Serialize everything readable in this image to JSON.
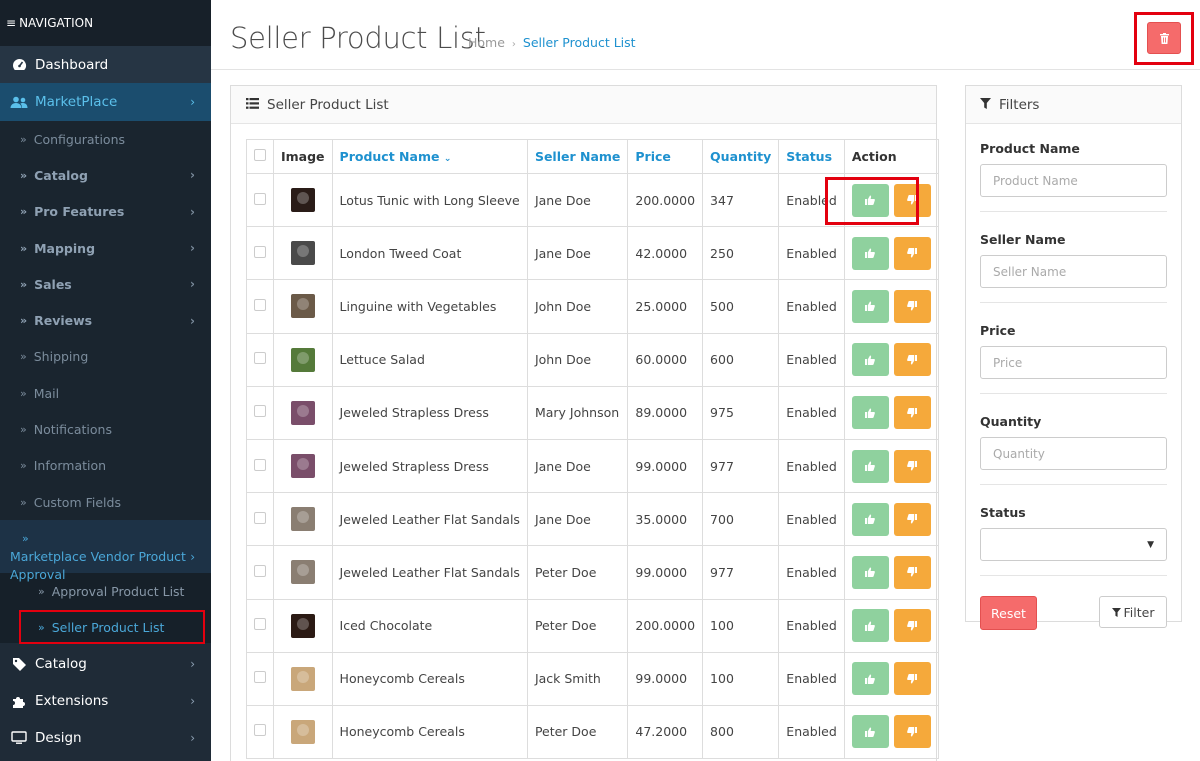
{
  "sidebar": {
    "heading": "NAVIGATION",
    "dashboard": "Dashboard",
    "marketplace": "MarketPlace",
    "marketplace_sub": [
      {
        "label": "Configurations",
        "bold": false,
        "chev": false
      },
      {
        "label": "Catalog",
        "bold": true,
        "chev": true
      },
      {
        "label": "Pro Features",
        "bold": true,
        "chev": true
      },
      {
        "label": "Mapping",
        "bold": true,
        "chev": true
      },
      {
        "label": "Sales",
        "bold": true,
        "chev": true
      },
      {
        "label": "Reviews",
        "bold": true,
        "chev": true
      },
      {
        "label": "Shipping",
        "bold": false,
        "chev": false
      },
      {
        "label": "Mail",
        "bold": false,
        "chev": false
      },
      {
        "label": "Notifications",
        "bold": false,
        "chev": false
      },
      {
        "label": "Information",
        "bold": false,
        "chev": false
      },
      {
        "label": "Custom Fields",
        "bold": false,
        "chev": false
      }
    ],
    "mvpa": "Marketplace Vendor Product Approval",
    "approval_product_list": "Approval Product List",
    "seller_product_list": "Seller Product List",
    "catalog": "Catalog",
    "extensions": "Extensions",
    "design": "Design"
  },
  "header": {
    "title": "Seller Product List",
    "crumb_home": "Home",
    "crumb_current": "Seller Product List"
  },
  "panel": {
    "title": "Seller Product List",
    "columns": [
      "Image",
      "Product Name",
      "Seller Name",
      "Price",
      "Quantity",
      "Status",
      "Action"
    ],
    "rows": [
      {
        "name": "Lotus Tunic with Long Sleeve",
        "seller": "Jane Doe",
        "price": "200.0000",
        "qty": "347",
        "status": "Enabled",
        "img": "#2a1c18"
      },
      {
        "name": "London Tweed Coat",
        "seller": "Jane Doe",
        "price": "42.0000",
        "qty": "250",
        "status": "Enabled",
        "img": "#4a4a4a"
      },
      {
        "name": "Linguine with Vegetables",
        "seller": "John Doe",
        "price": "25.0000",
        "qty": "500",
        "status": "Enabled",
        "img": "#6b5a48"
      },
      {
        "name": "Lettuce Salad",
        "seller": "John Doe",
        "price": "60.0000",
        "qty": "600",
        "status": "Enabled",
        "img": "#557a3a"
      },
      {
        "name": "Jeweled Strapless Dress",
        "seller": "Mary Johnson",
        "price": "89.0000",
        "qty": "975",
        "status": "Enabled",
        "img": "#7a4e6a"
      },
      {
        "name": "Jeweled Strapless Dress",
        "seller": "Jane Doe",
        "price": "99.0000",
        "qty": "977",
        "status": "Enabled",
        "img": "#7a4e6a"
      },
      {
        "name": "Jeweled Leather Flat Sandals",
        "seller": "Jane Doe",
        "price": "35.0000",
        "qty": "700",
        "status": "Enabled",
        "img": "#8a7e72"
      },
      {
        "name": "Jeweled Leather Flat Sandals",
        "seller": "Peter Doe",
        "price": "99.0000",
        "qty": "977",
        "status": "Enabled",
        "img": "#8a7e72"
      },
      {
        "name": "Iced Chocolate",
        "seller": "Peter Doe",
        "price": "200.0000",
        "qty": "100",
        "status": "Enabled",
        "img": "#2b1a14"
      },
      {
        "name": "Honeycomb Cereals",
        "seller": "Jack Smith",
        "price": "99.0000",
        "qty": "100",
        "status": "Enabled",
        "img": "#c9a77a"
      },
      {
        "name": "Honeycomb Cereals",
        "seller": "Peter Doe",
        "price": "47.2000",
        "qty": "800",
        "status": "Enabled",
        "img": "#c9a77a"
      }
    ]
  },
  "filters": {
    "title": "Filters",
    "fields": [
      {
        "label": "Product Name",
        "placeholder": "Product Name"
      },
      {
        "label": "Seller Name",
        "placeholder": "Seller Name"
      },
      {
        "label": "Price",
        "placeholder": "Price"
      },
      {
        "label": "Quantity",
        "placeholder": "Quantity"
      }
    ],
    "status_label": "Status",
    "reset": "Reset",
    "filter": "Filter"
  },
  "colors": {
    "sidebar_bg": "#1f2b37",
    "accent": "#1e91cf",
    "approve": "#8fd19e",
    "disapprove": "#f5a93b",
    "danger": "#f56b6b",
    "highlight": "#e3000f"
  }
}
